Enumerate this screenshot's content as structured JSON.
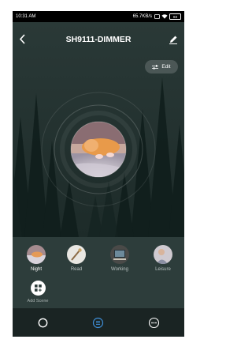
{
  "status_bar": {
    "time": "10:31 AM",
    "network_speed": "65.7KB/s",
    "battery": "83"
  },
  "header": {
    "title": "SH9111-DIMMER",
    "back_icon": "chevron-left-icon",
    "edit_icon": "pencil-icon"
  },
  "edit_button": {
    "label": "Edit",
    "icon": "sliders-icon"
  },
  "scenes": [
    {
      "label": "Night",
      "active": true
    },
    {
      "label": "Read",
      "active": false
    },
    {
      "label": "Working",
      "active": false
    },
    {
      "label": "Leisure",
      "active": false
    }
  ],
  "add_scene": {
    "label": "Add Scene",
    "icon": "add-grid-icon"
  },
  "bottom_nav": [
    {
      "icon": "power-icon",
      "active": false
    },
    {
      "icon": "list-icon",
      "active": true
    },
    {
      "icon": "more-icon",
      "active": false
    }
  ],
  "colors": {
    "accent": "#3f8fd8",
    "background": "#1b2a29",
    "panel": "#2d3d3b",
    "nav": "#1a2423"
  }
}
